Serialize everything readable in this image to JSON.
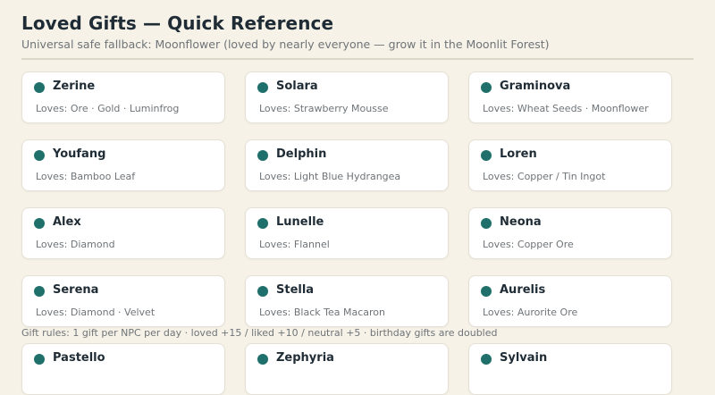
{
  "header": {
    "title": "Loved Gifts — Quick Reference",
    "subtitle": "Universal safe fallback: Moonflower (loved by nearly everyone — grow it in the Moonlit Forest)"
  },
  "loves_prefix": "Loves: ",
  "npcs": [
    {
      "name": "Zerine",
      "loves": "Ore · Gold · Luminfrog"
    },
    {
      "name": "Solara",
      "loves": "Strawberry Mousse"
    },
    {
      "name": "Graminova",
      "loves": "Wheat Seeds · Moonflower"
    },
    {
      "name": "Youfang",
      "loves": "Bamboo Leaf"
    },
    {
      "name": "Delphin",
      "loves": "Light Blue Hydrangea"
    },
    {
      "name": "Loren",
      "loves": "Copper / Tin Ingot"
    },
    {
      "name": "Alex",
      "loves": "Diamond"
    },
    {
      "name": "Lunelle",
      "loves": "Flannel"
    },
    {
      "name": "Neona",
      "loves": "Copper Ore"
    },
    {
      "name": "Serena",
      "loves": "Diamond · Velvet"
    },
    {
      "name": "Stella",
      "loves": "Black Tea Macaron"
    },
    {
      "name": "Aurelis",
      "loves": "Aurorite Ore"
    },
    {
      "name": "Pastello",
      "loves": ""
    },
    {
      "name": "Zephyria",
      "loves": ""
    },
    {
      "name": "Sylvain",
      "loves": ""
    }
  ],
  "footer": {
    "rules": "Gift rules: 1 gift per NPC per day · loved +15 / liked +10 / neutral +5 · birthday gifts are doubled"
  },
  "colors": {
    "accent_dot": "#1f6f6a",
    "background": "#f6f2e8"
  }
}
